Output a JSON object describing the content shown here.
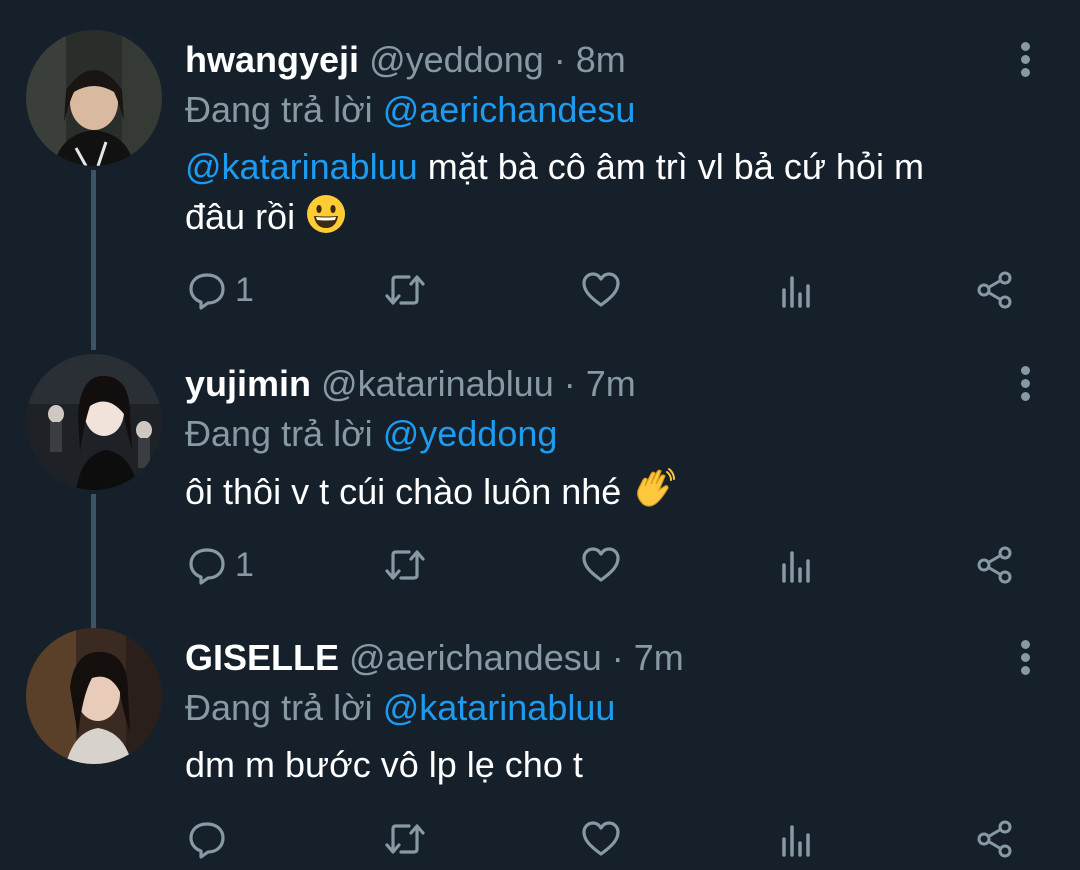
{
  "reply_label": "Đang trả lời",
  "colors": {
    "background": "#15202b",
    "secondary": "#8899a6",
    "accent": "#1d9bf0",
    "thread_line": "#3d5466"
  },
  "tweets": [
    {
      "name": "hwangyeji",
      "handle": "@yeddong",
      "separator": "·",
      "time": "8m",
      "reply_to": "@aerichandesu",
      "mention": "@katarinabluu",
      "text_line1": " mặt bà cô âm trì vl bả cứ hỏi m",
      "text_line2": "đâu rồi",
      "emoji": "grinning-face",
      "reply_count": "1"
    },
    {
      "name": "yujimin",
      "handle": "@katarinabluu",
      "separator": "·",
      "time": "7m",
      "reply_to": "@yeddong",
      "text": "ôi thôi v t cúi chào luôn nhé",
      "emoji": "waving-hand",
      "reply_count": "1"
    },
    {
      "name": "GISELLE",
      "handle": "@aerichandesu",
      "separator": "·",
      "time": "7m",
      "reply_to": "@katarinabluu",
      "text": "dm m bước vô lp lẹ cho t",
      "reply_count": ""
    }
  ]
}
